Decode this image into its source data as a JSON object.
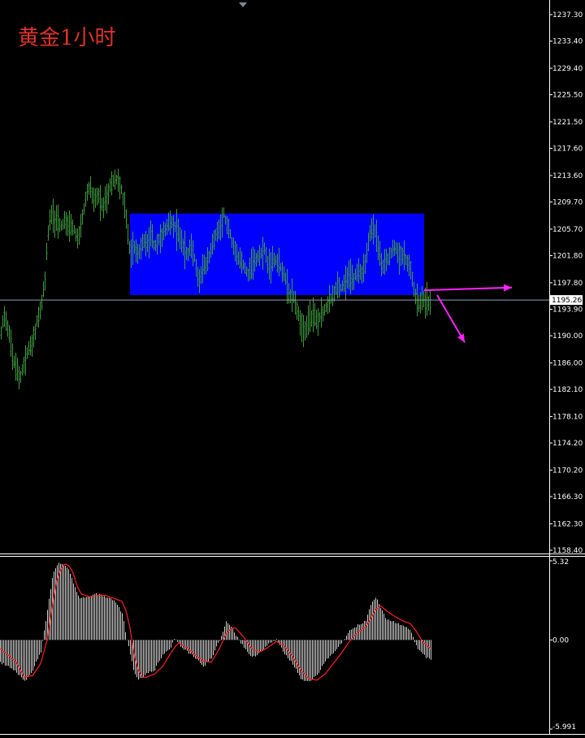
{
  "title": "黄金1小时",
  "colors": {
    "background": "#000000",
    "candle": "#3f9b3f",
    "zone": "#0000ff",
    "arrow": "#ff22ff",
    "signal": "#ff2020",
    "histogram": "#cfcfcf",
    "price_line": "#8aa0b8",
    "axis": "#ffffff"
  },
  "chart_data": [
    {
      "type": "ohlc-bars",
      "title": "黄金1小时",
      "ylim": [
        1158.4,
        1237.3
      ],
      "y_ticks": [
        "1237.30",
        "1233.40",
        "1229.40",
        "1225.50",
        "1221.50",
        "1217.60",
        "1213.60",
        "1209.70",
        "1205.70",
        "1201.80",
        "1197.80",
        "1193.90",
        "1190.00",
        "1186.00",
        "1182.10",
        "1178.10",
        "1174.20",
        "1170.20",
        "1166.30",
        "1162.30",
        "1158.40"
      ],
      "current_price": "1195.26",
      "price_path": [
        [
          0,
          1190
        ],
        [
          5,
          1193
        ],
        [
          10,
          1191
        ],
        [
          15,
          1187
        ],
        [
          20,
          1185
        ],
        [
          25,
          1184
        ],
        [
          30,
          1186
        ],
        [
          35,
          1188
        ],
        [
          40,
          1189
        ],
        [
          45,
          1192
        ],
        [
          50,
          1194
        ],
        [
          55,
          1198
        ],
        [
          58,
          1204
        ],
        [
          62,
          1208
        ],
        [
          66,
          1207
        ],
        [
          70,
          1207
        ],
        [
          75,
          1206
        ],
        [
          80,
          1207
        ],
        [
          85,
          1206
        ],
        [
          90,
          1206
        ],
        [
          95,
          1204
        ],
        [
          100,
          1207
        ],
        [
          105,
          1210
        ],
        [
          110,
          1212
        ],
        [
          115,
          1210
        ],
        [
          120,
          1211
        ],
        [
          125,
          1209
        ],
        [
          130,
          1210
        ],
        [
          135,
          1212
        ],
        [
          140,
          1213
        ],
        [
          145,
          1213
        ],
        [
          150,
          1211
        ],
        [
          155,
          1207
        ],
        [
          160,
          1202
        ],
        [
          165,
          1203
        ],
        [
          170,
          1202
        ],
        [
          175,
          1204
        ],
        [
          180,
          1203
        ],
        [
          185,
          1205
        ],
        [
          190,
          1203
        ],
        [
          195,
          1204
        ],
        [
          200,
          1205
        ],
        [
          205,
          1206
        ],
        [
          210,
          1207
        ],
        [
          215,
          1206
        ],
        [
          220,
          1205
        ],
        [
          225,
          1203
        ],
        [
          230,
          1202
        ],
        [
          235,
          1203
        ],
        [
          240,
          1201
        ],
        [
          245,
          1198
        ],
        [
          250,
          1200
        ],
        [
          255,
          1201
        ],
        [
          260,
          1203
        ],
        [
          265,
          1205
        ],
        [
          270,
          1206
        ],
        [
          275,
          1208
        ],
        [
          280,
          1206
        ],
        [
          285,
          1204
        ],
        [
          290,
          1202
        ],
        [
          295,
          1201
        ],
        [
          300,
          1200
        ],
        [
          305,
          1199
        ],
        [
          310,
          1200
        ],
        [
          315,
          1201
        ],
        [
          320,
          1202
        ],
        [
          325,
          1203
        ],
        [
          330,
          1200
        ],
        [
          335,
          1201
        ],
        [
          340,
          1201
        ],
        [
          345,
          1200
        ],
        [
          350,
          1199
        ],
        [
          355,
          1196
        ],
        [
          360,
          1196
        ],
        [
          365,
          1194
        ],
        [
          370,
          1192
        ],
        [
          375,
          1191
        ],
        [
          380,
          1192
        ],
        [
          385,
          1193
        ],
        [
          390,
          1192
        ],
        [
          395,
          1193
        ],
        [
          400,
          1194
        ],
        [
          405,
          1195
        ],
        [
          410,
          1196
        ],
        [
          415,
          1197
        ],
        [
          420,
          1197
        ],
        [
          425,
          1198
        ],
        [
          430,
          1199
        ],
        [
          435,
          1198
        ],
        [
          440,
          1200
        ],
        [
          445,
          1199
        ],
        [
          450,
          1201
        ],
        [
          455,
          1205
        ],
        [
          460,
          1206
        ],
        [
          465,
          1203
        ],
        [
          470,
          1200
        ],
        [
          475,
          1201
        ],
        [
          480,
          1202
        ],
        [
          485,
          1203
        ],
        [
          490,
          1202
        ],
        [
          495,
          1202
        ],
        [
          500,
          1201
        ],
        [
          505,
          1200
        ],
        [
          510,
          1196
        ],
        [
          515,
          1195
        ],
        [
          520,
          1195
        ],
        [
          525,
          1195
        ],
        [
          530,
          1195
        ]
      ],
      "zone": {
        "x_start": 160,
        "x_end": 522,
        "price_top": 1208.0,
        "price_bottom": 1196.0
      },
      "arrows": [
        {
          "from_x": 522,
          "from_price": 1196.7,
          "to_x": 630,
          "to_price": 1197.1
        },
        {
          "from_x": 538,
          "from_price": 1196.0,
          "to_x": 572,
          "to_price": 1189.0
        }
      ]
    },
    {
      "type": "histogram",
      "ylim": [
        -5.991,
        5.32
      ],
      "y_ticks": [
        "5.32",
        "0.00",
        "-5.991"
      ],
      "hist_path": [
        [
          0,
          -1.5
        ],
        [
          10,
          -1.8
        ],
        [
          20,
          -2.2
        ],
        [
          30,
          -2.8
        ],
        [
          40,
          -2.0
        ],
        [
          50,
          -0.8
        ],
        [
          58,
          2.0
        ],
        [
          65,
          4.5
        ],
        [
          70,
          5.1
        ],
        [
          75,
          5.2
        ],
        [
          80,
          5.0
        ],
        [
          85,
          4.6
        ],
        [
          90,
          3.8
        ],
        [
          95,
          3.0
        ],
        [
          100,
          2.8
        ],
        [
          110,
          3.0
        ],
        [
          120,
          3.1
        ],
        [
          130,
          2.9
        ],
        [
          140,
          2.7
        ],
        [
          150,
          1.8
        ],
        [
          155,
          0.3
        ],
        [
          160,
          -1.0
        ],
        [
          165,
          -2.2
        ],
        [
          170,
          -2.6
        ],
        [
          175,
          -2.5
        ],
        [
          180,
          -2.3
        ],
        [
          190,
          -2.0
        ],
        [
          200,
          -1.0
        ],
        [
          210,
          -0.5
        ],
        [
          215,
          0.2
        ],
        [
          220,
          -0.3
        ],
        [
          230,
          -0.8
        ],
        [
          240,
          -1.2
        ],
        [
          250,
          -1.8
        ],
        [
          260,
          -1.2
        ],
        [
          270,
          0.0
        ],
        [
          278,
          1.2
        ],
        [
          285,
          0.9
        ],
        [
          290,
          0.3
        ],
        [
          300,
          -0.5
        ],
        [
          310,
          -1.2
        ],
        [
          320,
          -0.8
        ],
        [
          330,
          -0.3
        ],
        [
          340,
          0.0
        ],
        [
          350,
          -0.9
        ],
        [
          360,
          -1.6
        ],
        [
          370,
          -2.6
        ],
        [
          380,
          -2.8
        ],
        [
          390,
          -2.4
        ],
        [
          400,
          -1.4
        ],
        [
          410,
          -0.9
        ],
        [
          420,
          -0.2
        ],
        [
          430,
          0.6
        ],
        [
          440,
          1.0
        ],
        [
          450,
          1.3
        ],
        [
          455,
          2.3
        ],
        [
          462,
          2.9
        ],
        [
          468,
          2.2
        ],
        [
          475,
          1.4
        ],
        [
          485,
          1.2
        ],
        [
          495,
          1.0
        ],
        [
          505,
          0.6
        ],
        [
          512,
          -0.4
        ],
        [
          520,
          -1.0
        ],
        [
          530,
          -1.4
        ]
      ],
      "signal_path": [
        [
          0,
          -0.6
        ],
        [
          10,
          -1.0
        ],
        [
          20,
          -1.5
        ],
        [
          30,
          -2.5
        ],
        [
          40,
          -2.4
        ],
        [
          50,
          -1.6
        ],
        [
          58,
          0.0
        ],
        [
          65,
          2.5
        ],
        [
          70,
          4.0
        ],
        [
          75,
          4.8
        ],
        [
          80,
          5.1
        ],
        [
          85,
          5.0
        ],
        [
          90,
          4.5
        ],
        [
          95,
          3.6
        ],
        [
          100,
          3.1
        ],
        [
          110,
          2.9
        ],
        [
          120,
          3.0
        ],
        [
          130,
          3.0
        ],
        [
          140,
          2.8
        ],
        [
          150,
          2.6
        ],
        [
          155,
          2.0
        ],
        [
          160,
          0.8
        ],
        [
          165,
          -1.0
        ],
        [
          170,
          -2.0
        ],
        [
          175,
          -2.5
        ],
        [
          180,
          -2.5
        ],
        [
          190,
          -2.3
        ],
        [
          200,
          -1.8
        ],
        [
          210,
          -0.9
        ],
        [
          215,
          -0.5
        ],
        [
          220,
          -0.2
        ],
        [
          230,
          -0.5
        ],
        [
          240,
          -1.0
        ],
        [
          250,
          -1.4
        ],
        [
          260,
          -1.5
        ],
        [
          270,
          -0.6
        ],
        [
          278,
          0.4
        ],
        [
          285,
          0.8
        ],
        [
          290,
          0.8
        ],
        [
          300,
          0.2
        ],
        [
          310,
          -0.6
        ],
        [
          320,
          -0.8
        ],
        [
          330,
          -0.5
        ],
        [
          340,
          -0.1
        ],
        [
          350,
          -0.4
        ],
        [
          360,
          -1.1
        ],
        [
          370,
          -2.0
        ],
        [
          380,
          -2.6
        ],
        [
          390,
          -2.7
        ],
        [
          400,
          -2.3
        ],
        [
          410,
          -1.6
        ],
        [
          420,
          -0.9
        ],
        [
          430,
          -0.1
        ],
        [
          440,
          0.5
        ],
        [
          450,
          0.9
        ],
        [
          455,
          1.3
        ],
        [
          462,
          2.0
        ],
        [
          468,
          2.3
        ],
        [
          475,
          2.0
        ],
        [
          485,
          1.6
        ],
        [
          495,
          1.3
        ],
        [
          505,
          1.1
        ],
        [
          512,
          0.6
        ],
        [
          520,
          -0.1
        ],
        [
          530,
          -0.6
        ]
      ]
    }
  ]
}
